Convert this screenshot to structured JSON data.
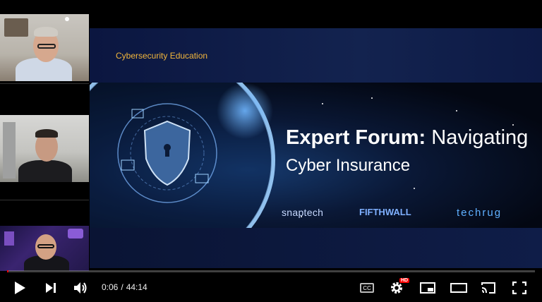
{
  "slide": {
    "subtitle": "Cybersecurity Education",
    "title_bold": "Expert Forum:",
    "title_rest": "Navigating",
    "title_line2": "Cyber Insurance",
    "logos": [
      "snaptech",
      "FIFTHWALL",
      "techrug"
    ]
  },
  "player": {
    "current_time": "0:06",
    "separator": "/",
    "duration": "44:14",
    "progress": 0.0023,
    "accent_color": "#ff0000",
    "hd_badge": "HD",
    "cc_label": "CC"
  }
}
